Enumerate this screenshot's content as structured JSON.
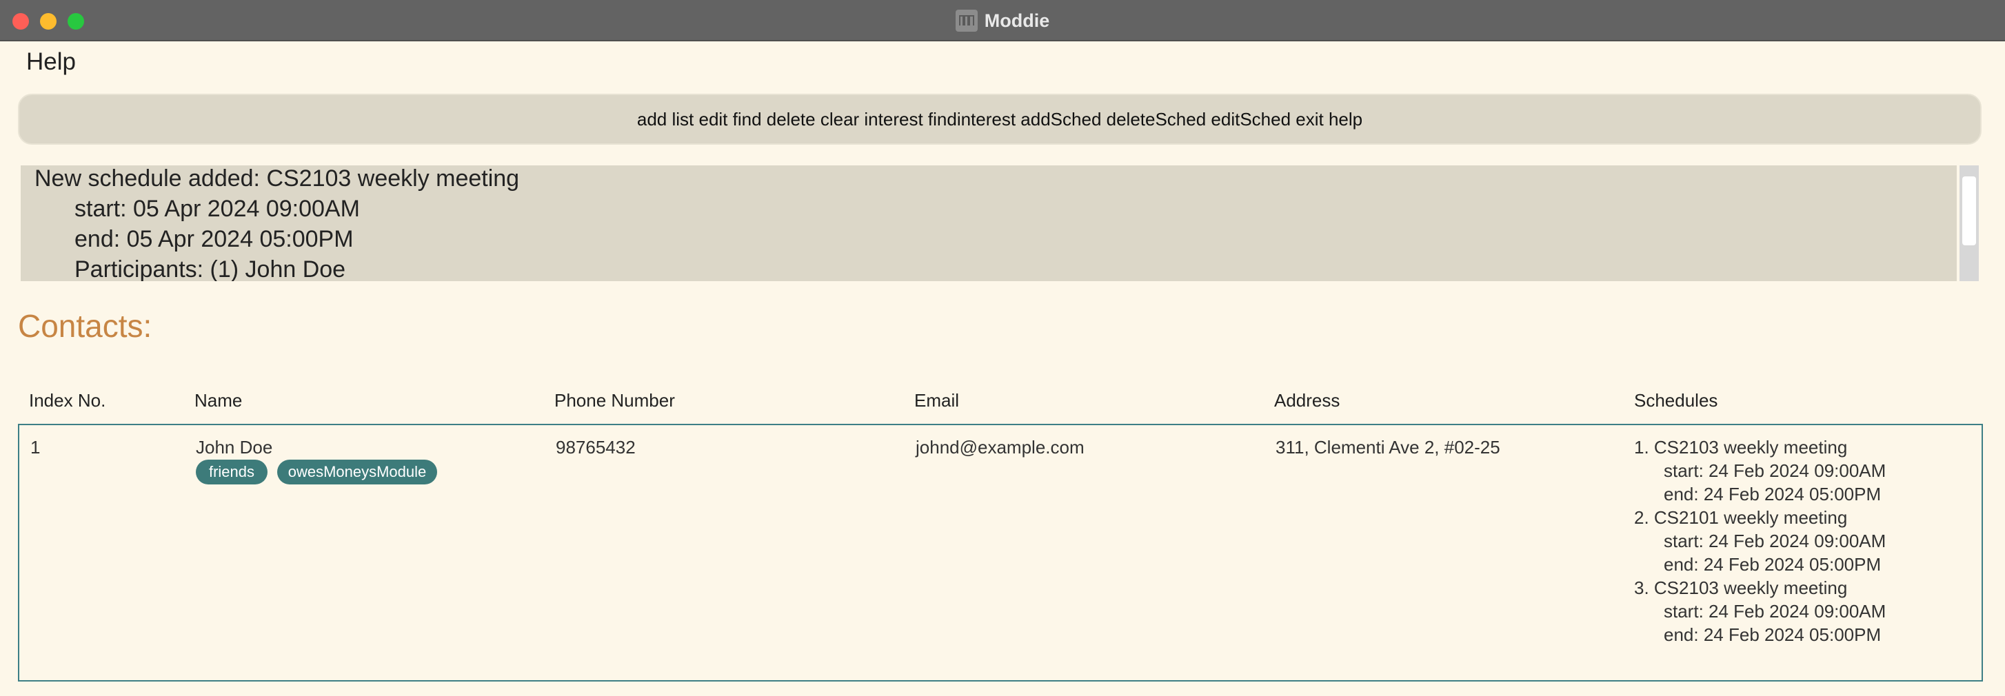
{
  "window": {
    "title": "Moddie"
  },
  "menu": {
    "help": "Help"
  },
  "command_bar": {
    "text": "add list edit find delete clear interest findinterest addSched deleteSched editSched exit help"
  },
  "result": {
    "lines": [
      "New schedule added: CS2103 weekly meeting",
      "start: 05 Apr 2024 09:00AM",
      "end: 05 Apr 2024 05:00PM",
      "Participants: (1) John Doe"
    ]
  },
  "contacts": {
    "heading": "Contacts:",
    "columns": [
      "Index No.",
      "Name",
      "Phone Number",
      "Email",
      "Address",
      "Schedules"
    ],
    "rows": [
      {
        "index": "1",
        "name": "John Doe",
        "tags": [
          "friends",
          "owesMoneysModule"
        ],
        "phone": "98765432",
        "email": "johnd@example.com",
        "address": "311, Clementi Ave 2, #02-25",
        "schedules": [
          {
            "title": "1. CS2103 weekly meeting",
            "start": "start: 24 Feb 2024 09:00AM",
            "end": "end: 24 Feb 2024 05:00PM"
          },
          {
            "title": "2. CS2101 weekly meeting",
            "start": "start: 24 Feb 2024 09:00AM",
            "end": "end: 24 Feb 2024 05:00PM"
          },
          {
            "title": "3. CS2103 weekly meeting",
            "start": "start: 24 Feb 2024 09:00AM",
            "end": "end: 24 Feb 2024 05:00PM"
          }
        ]
      }
    ]
  },
  "colors": {
    "background": "#fdf7e9",
    "panel": "#dcd7c8",
    "heading_accent": "#c78544",
    "tag": "#3d7b7a",
    "row_border": "#3d7f86"
  }
}
